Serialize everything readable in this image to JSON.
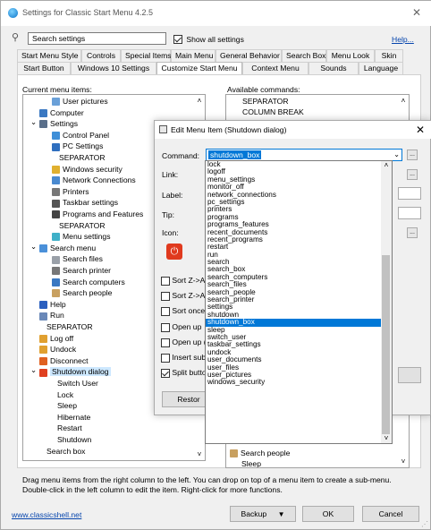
{
  "window": {
    "title": "Settings for Classic Start Menu 4.2.5"
  },
  "search": {
    "placeholder": "Search settings",
    "show_all_label": "Show all settings",
    "help_label": "Help..."
  },
  "tabs_row1": [
    "Start Menu Style",
    "Controls",
    "Special Items",
    "Main Menu",
    "General Behavior",
    "Search Box",
    "Menu Look",
    "Skin"
  ],
  "tabs_row2": [
    "Start Button",
    "Windows 10 Settings",
    "Customize Start Menu",
    "Context Menu",
    "Sounds",
    "Language"
  ],
  "current_items_label": "Current menu items:",
  "available_label": "Available commands:",
  "tree_items": [
    {
      "label": "User pictures",
      "indent": 2,
      "icon": "pictures-icon",
      "color": "#6aa0d8"
    },
    {
      "label": "Computer",
      "indent": 1,
      "icon": "computer-icon",
      "color": "#3a78c2"
    },
    {
      "label": "Settings",
      "indent": 1,
      "icon": "settings-icon",
      "color": "#5a6f8a",
      "expand": "v"
    },
    {
      "label": "Control Panel",
      "indent": 2,
      "icon": "control-panel-icon",
      "color": "#3f8fd8"
    },
    {
      "label": "PC Settings",
      "indent": 2,
      "icon": "gear-icon",
      "color": "#2f6fbf"
    },
    {
      "label": "SEPARATOR",
      "indent": 2,
      "icon": "",
      "color": ""
    },
    {
      "label": "Windows security",
      "indent": 2,
      "icon": "lock-icon",
      "color": "#e0b030"
    },
    {
      "label": "Network Connections",
      "indent": 2,
      "icon": "network-icon",
      "color": "#4a8ad0"
    },
    {
      "label": "Printers",
      "indent": 2,
      "icon": "printer-icon",
      "color": "#777777"
    },
    {
      "label": "Taskbar settings",
      "indent": 2,
      "icon": "taskbar-icon",
      "color": "#555555"
    },
    {
      "label": "Programs and Features",
      "indent": 2,
      "icon": "programs-icon",
      "color": "#444444"
    },
    {
      "label": "SEPARATOR",
      "indent": 2,
      "icon": "",
      "color": ""
    },
    {
      "label": "Menu settings",
      "indent": 2,
      "icon": "menu-icon",
      "color": "#3fb0c8"
    },
    {
      "label": "Search menu",
      "indent": 1,
      "icon": "search-icon",
      "color": "#4a90d9",
      "expand": "v"
    },
    {
      "label": "Search files",
      "indent": 2,
      "icon": "file-icon",
      "color": "#9aa0a8"
    },
    {
      "label": "Search printer",
      "indent": 2,
      "icon": "printer-icon",
      "color": "#777777"
    },
    {
      "label": "Search computers",
      "indent": 2,
      "icon": "computer-icon",
      "color": "#3a78c2"
    },
    {
      "label": "Search people",
      "indent": 2,
      "icon": "people-icon",
      "color": "#c8a060"
    },
    {
      "label": "Help",
      "indent": 1,
      "icon": "help-icon",
      "color": "#2a5fbf"
    },
    {
      "label": "Run",
      "indent": 1,
      "icon": "run-icon",
      "color": "#6a88b8"
    },
    {
      "label": "SEPARATOR",
      "indent": 1,
      "icon": "",
      "color": ""
    },
    {
      "label": "Log off",
      "indent": 1,
      "icon": "logoff-icon",
      "color": "#e0a030"
    },
    {
      "label": "Undock",
      "indent": 1,
      "icon": "undock-icon",
      "color": "#e0a030"
    },
    {
      "label": "Disconnect",
      "indent": 1,
      "icon": "disconnect-icon",
      "color": "#e06020"
    },
    {
      "label": "Shutdown dialog",
      "indent": 1,
      "icon": "power-icon",
      "color": "#e04020",
      "expand": "v",
      "selected": true
    },
    {
      "label": "Switch User",
      "indent": 2,
      "icon": "",
      "color": ""
    },
    {
      "label": "Lock",
      "indent": 2,
      "icon": "",
      "color": ""
    },
    {
      "label": "Sleep",
      "indent": 2,
      "icon": "",
      "color": ""
    },
    {
      "label": "Hibernate",
      "indent": 2,
      "icon": "",
      "color": ""
    },
    {
      "label": "Restart",
      "indent": 2,
      "icon": "",
      "color": ""
    },
    {
      "label": "Shutdown",
      "indent": 2,
      "icon": "",
      "color": ""
    },
    {
      "label": "Search box",
      "indent": 1,
      "icon": "",
      "color": ""
    }
  ],
  "available_items": [
    "SEPARATOR",
    "COLUMN BREAK"
  ],
  "available_bottom_items": [
    "Search people",
    "Sleep"
  ],
  "dialog": {
    "title": "Edit Menu Item (Shutdown dialog)",
    "command_label": "Command:",
    "command_value": "shutdown_box",
    "link_label": "Link:",
    "label_label": "Label:",
    "tip_label": "Tip:",
    "icon_label": "Icon:",
    "sort_az_label": "Sort Z->A",
    "sort_az2_label": "Sort Z->A",
    "sort_once_label": "Sort once",
    "open_up_label": "Open up",
    "open_up2_label": "Open up (",
    "insert_label": "Insert sub",
    "split_label": "Split butto",
    "restore_label": "Restor",
    "ellipsis": "...",
    "dropdown": [
      "lock",
      "logoff",
      "menu_settings",
      "monitor_off",
      "network_connections",
      "pc_settings",
      "printers",
      "programs",
      "programs_features",
      "recent_documents",
      "recent_programs",
      "restart",
      "run",
      "search",
      "search_box",
      "search_computers",
      "search_files",
      "search_people",
      "search_printer",
      "settings",
      "shutdown",
      "shutdown_box",
      "sleep",
      "switch_user",
      "taskbar_settings",
      "undock",
      "user_documents",
      "user_files",
      "user_pictures",
      "windows_security"
    ],
    "dropdown_selected": "shutdown_box"
  },
  "hint_line1": "Drag menu items from the right column to the left. You can drop on top of a menu item to create a sub-menu.",
  "hint_line2": "Double-click in the left column to edit the item. Right-click for more functions.",
  "footer": {
    "link": "www.classicshell.net",
    "backup": "Backup",
    "ok": "OK",
    "cancel": "Cancel"
  },
  "colors": {
    "accent": "#0078d7",
    "link": "#0645ad"
  }
}
